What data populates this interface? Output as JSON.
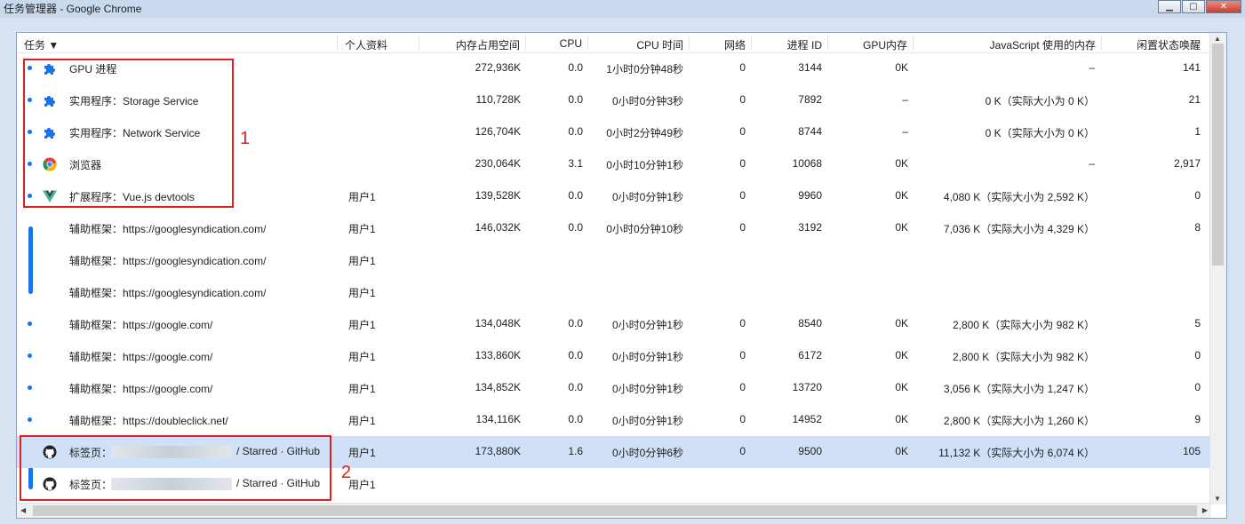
{
  "window": {
    "title": "任务管理器 - Google Chrome",
    "buttons": [
      "minimize",
      "maximize",
      "close"
    ]
  },
  "columns": [
    "任务 ▼",
    "个人资料",
    "内存占用空间",
    "CPU",
    "CPU 时间",
    "网络",
    "进程 ID",
    "GPU内存",
    "JavaScript 使用的内存",
    "闲置状态唤醒"
  ],
  "rows": [
    {
      "icon": "puzzle-icon",
      "task": "GPU 进程",
      "profile": "",
      "memory": "272,936K",
      "cpu": "0.0",
      "cpu_time": "1小时0分钟48秒",
      "network": "0",
      "pid": "3144",
      "gpu": "0K",
      "js": "–",
      "idle": "141"
    },
    {
      "icon": "puzzle-icon",
      "task": "实用程序：Storage Service",
      "profile": "",
      "memory": "110,728K",
      "cpu": "0.0",
      "cpu_time": "0小时0分钟3秒",
      "network": "0",
      "pid": "7892",
      "gpu": "–",
      "js": "0 K（实际大小为 0 K）",
      "idle": "21"
    },
    {
      "icon": "puzzle-icon",
      "task": "实用程序：Network Service",
      "profile": "",
      "memory": "126,704K",
      "cpu": "0.0",
      "cpu_time": "0小时2分钟49秒",
      "network": "0",
      "pid": "8744",
      "gpu": "–",
      "js": "0 K（实际大小为 0 K）",
      "idle": "1"
    },
    {
      "icon": "chrome-icon",
      "task": "浏览器",
      "profile": "",
      "memory": "230,064K",
      "cpu": "3.1",
      "cpu_time": "0小时10分钟1秒",
      "network": "0",
      "pid": "10068",
      "gpu": "0K",
      "js": "–",
      "idle": "2,917"
    },
    {
      "icon": "vue-icon",
      "task": "扩展程序：Vue.js devtools",
      "profile": "用户1",
      "memory": "139,528K",
      "cpu": "0.0",
      "cpu_time": "0小时0分钟1秒",
      "network": "0",
      "pid": "9960",
      "gpu": "0K",
      "js": "4,080 K（实际大小为 2,592 K）",
      "idle": "0"
    },
    {
      "icon": "",
      "task": "辅助框架：https://googlesyndication.com/",
      "profile": "用户1",
      "memory": "146,032K",
      "cpu": "0.0",
      "cpu_time": "0小时0分钟10秒",
      "network": "0",
      "pid": "3192",
      "gpu": "0K",
      "js": "7,036 K（实际大小为 4,329 K）",
      "idle": "8"
    },
    {
      "icon": "",
      "task": "辅助框架：https://googlesyndication.com/",
      "profile": "用户1",
      "memory": "",
      "cpu": "",
      "cpu_time": "",
      "network": "",
      "pid": "",
      "gpu": "",
      "js": "",
      "idle": ""
    },
    {
      "icon": "",
      "task": "辅助框架：https://googlesyndication.com/",
      "profile": "用户1",
      "memory": "",
      "cpu": "",
      "cpu_time": "",
      "network": "",
      "pid": "",
      "gpu": "",
      "js": "",
      "idle": ""
    },
    {
      "icon": "",
      "task": "辅助框架：https://google.com/",
      "profile": "用户1",
      "memory": "134,048K",
      "cpu": "0.0",
      "cpu_time": "0小时0分钟1秒",
      "network": "0",
      "pid": "8540",
      "gpu": "0K",
      "js": "2,800 K（实际大小为 982 K）",
      "idle": "5"
    },
    {
      "icon": "",
      "task": "辅助框架：https://google.com/",
      "profile": "用户1",
      "memory": "133,860K",
      "cpu": "0.0",
      "cpu_time": "0小时0分钟1秒",
      "network": "0",
      "pid": "6172",
      "gpu": "0K",
      "js": "2,800 K（实际大小为 982 K）",
      "idle": "0"
    },
    {
      "icon": "",
      "task": "辅助框架：https://google.com/",
      "profile": "用户1",
      "memory": "134,852K",
      "cpu": "0.0",
      "cpu_time": "0小时0分钟1秒",
      "network": "0",
      "pid": "13720",
      "gpu": "0K",
      "js": "3,056 K（实际大小为 1,247 K）",
      "idle": "0"
    },
    {
      "icon": "",
      "task": "辅助框架：https://doubleclick.net/",
      "profile": "用户1",
      "memory": "134,116K",
      "cpu": "0.0",
      "cpu_time": "0小时0分钟1秒",
      "network": "0",
      "pid": "14952",
      "gpu": "0K",
      "js": "2,800 K（实际大小为 1,260 K）",
      "idle": "9"
    },
    {
      "icon": "github-icon",
      "task": "标签页：",
      "task_suffix": "/ Starred · GitHub",
      "profile": "用户1",
      "memory": "173,880K",
      "cpu": "1.6",
      "cpu_time": "0小时0分钟6秒",
      "network": "0",
      "pid": "9500",
      "gpu": "0K",
      "js": "11,132 K（实际大小为 6,074 K）",
      "idle": "105",
      "selected": true
    },
    {
      "icon": "github-icon",
      "task": "标签页：",
      "task_suffix": "/ Starred · GitHub",
      "profile": "用户1",
      "memory": "",
      "cpu": "",
      "cpu_time": "",
      "network": "",
      "pid": "",
      "gpu": "",
      "js": "",
      "idle": ""
    }
  ],
  "annotations": [
    {
      "label": "1"
    },
    {
      "label": "2"
    }
  ]
}
